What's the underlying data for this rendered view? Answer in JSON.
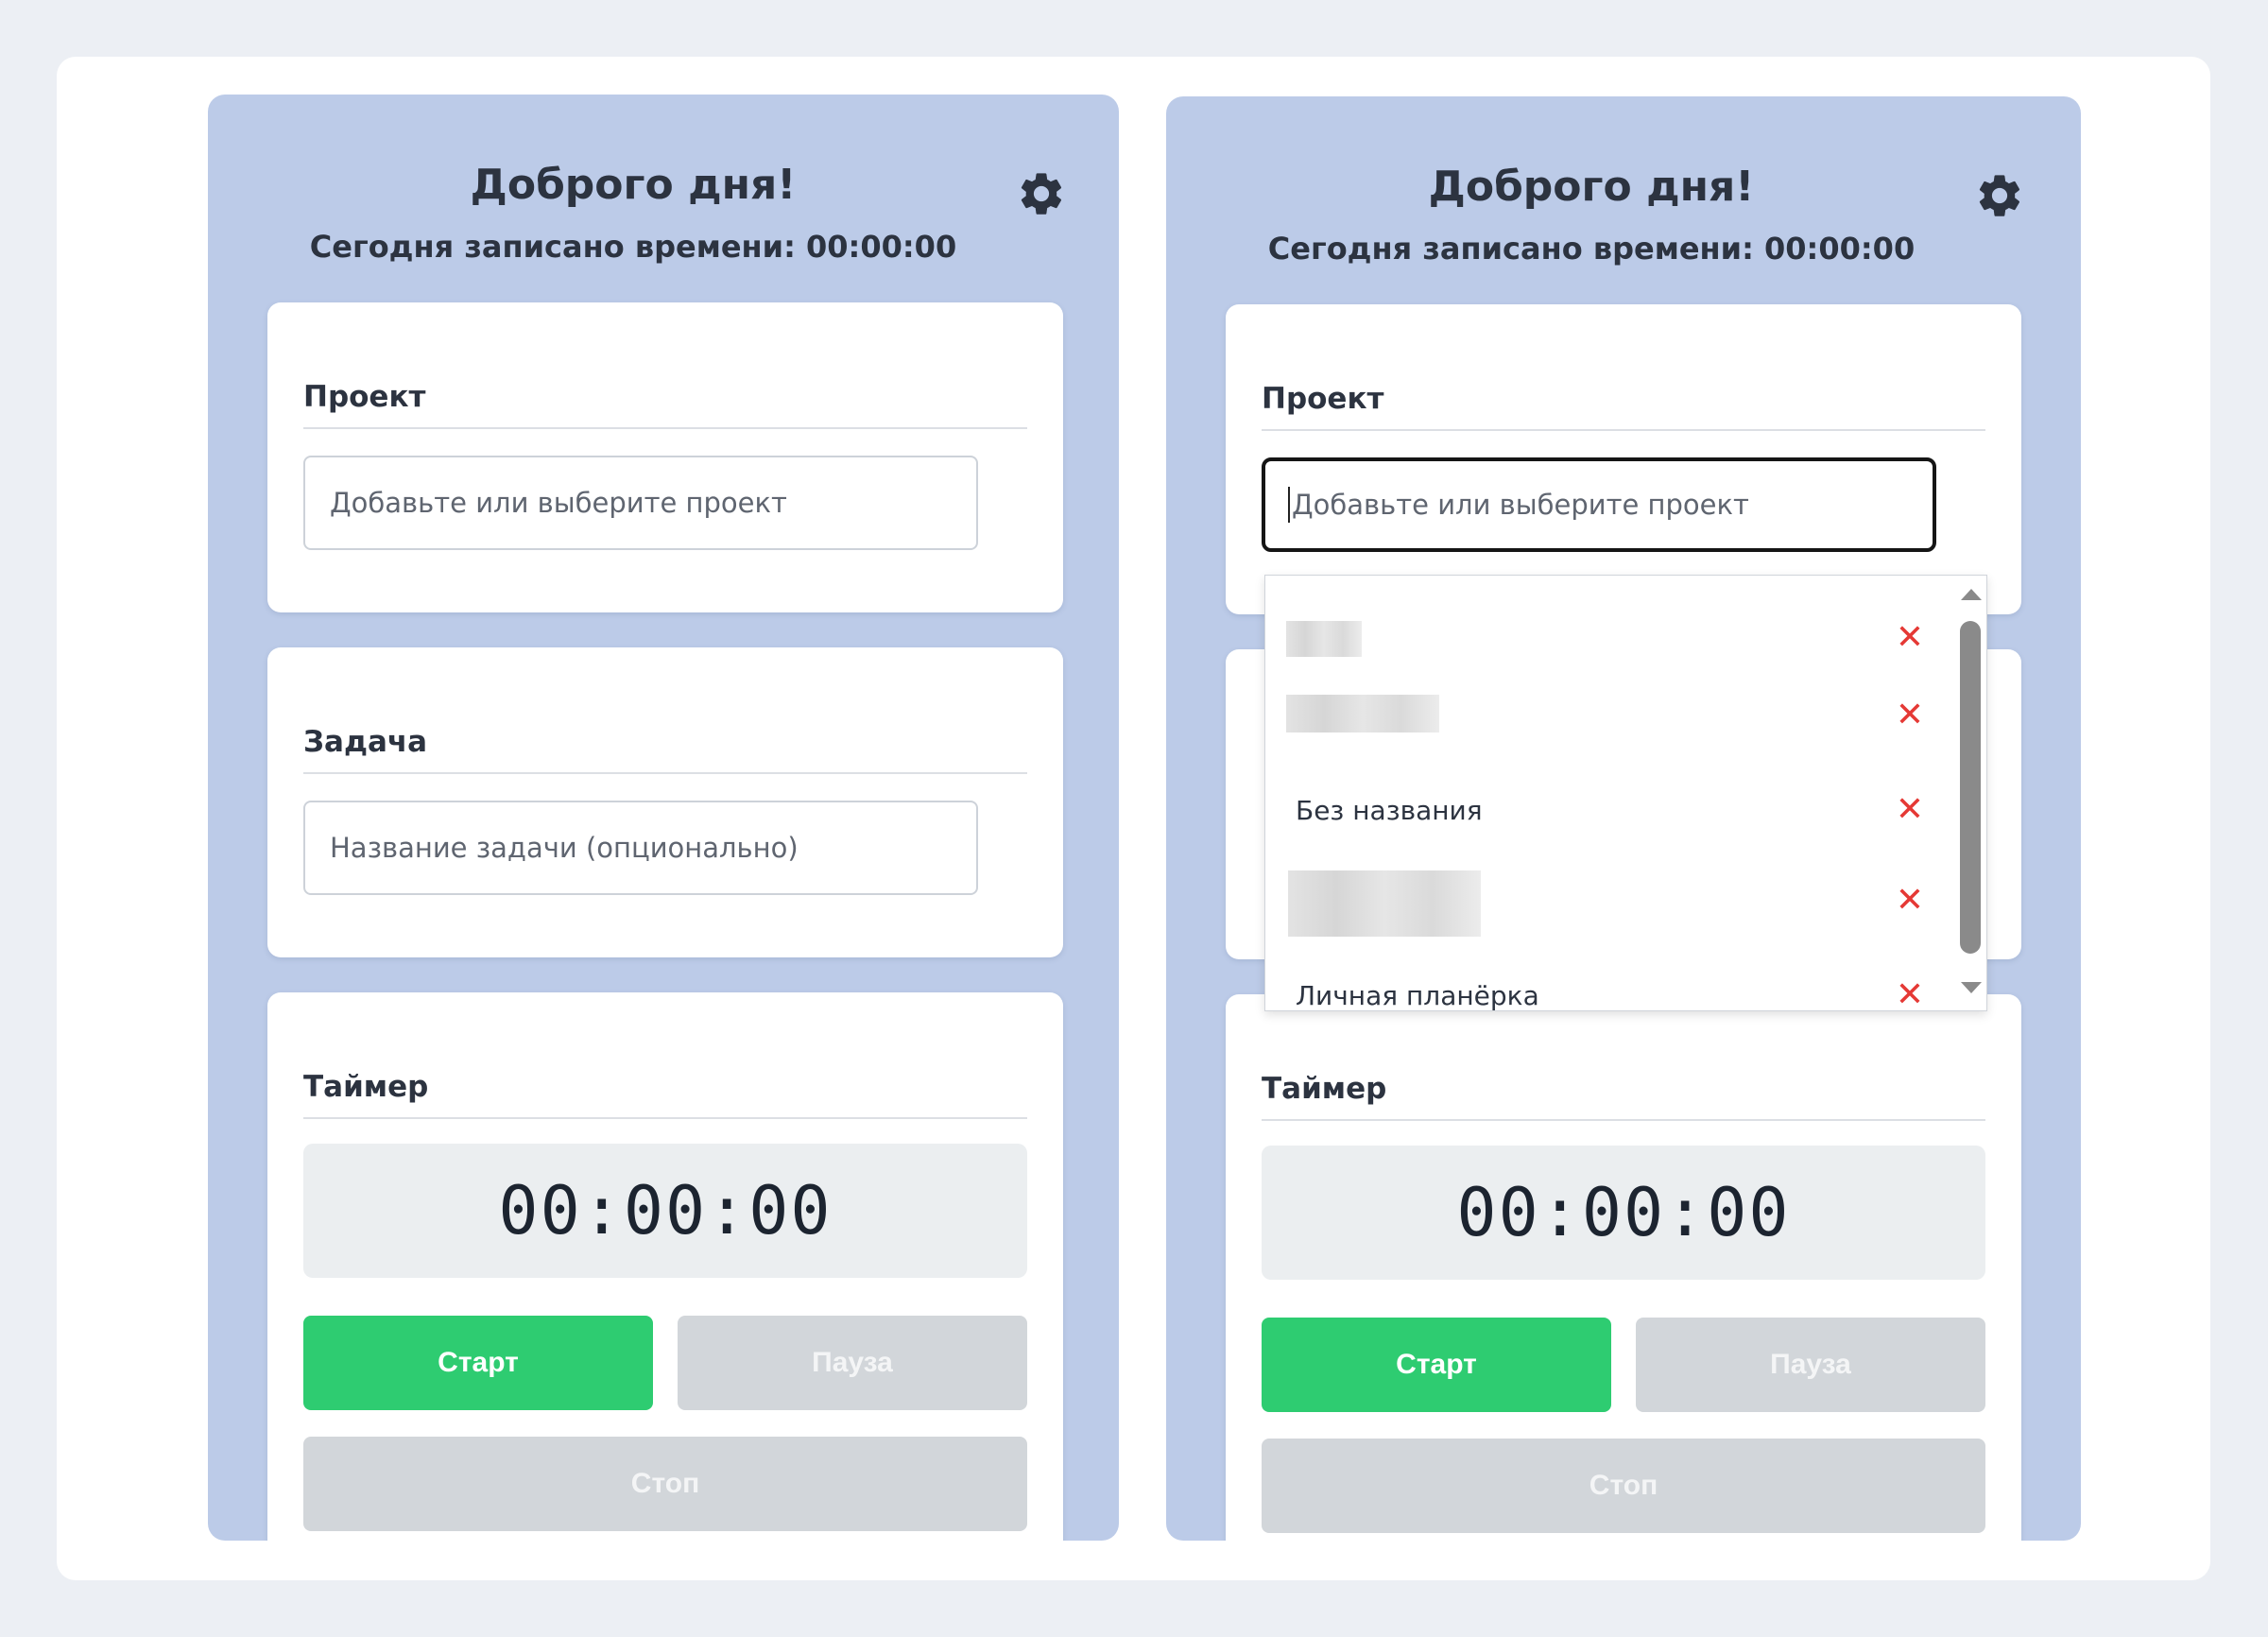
{
  "panels": [
    {
      "greeting": "Доброго дня!",
      "today_recorded": "Сегодня записано времени: 00:00:00",
      "project": {
        "title": "Проект",
        "placeholder": "Добавьте или выберите проект"
      },
      "task": {
        "title": "Задача",
        "placeholder": "Название задачи (опционально)"
      },
      "timer": {
        "title": "Таймер",
        "display": "00:00:00",
        "start_label": "Старт",
        "pause_label": "Пауза",
        "stop_label": "Стоп"
      }
    },
    {
      "greeting": "Доброго дня!",
      "today_recorded": "Сегодня записано времени: 00:00:00",
      "project": {
        "title": "Проект",
        "placeholder": "Добавьте или выберите проект"
      },
      "timer": {
        "title": "Таймер",
        "display": "00:00:00",
        "start_label": "Старт",
        "pause_label": "Пауза",
        "stop_label": "Стоп"
      }
    }
  ],
  "project_dropdown": {
    "items": [
      {
        "label": "",
        "blurred": true
      },
      {
        "label": "",
        "blurred": true
      },
      {
        "label": "Без названия",
        "blurred": false
      },
      {
        "label": "",
        "blurred": true
      },
      {
        "label": "Личная планёрка",
        "blurred": false
      }
    ],
    "delete_symbol": "✕"
  },
  "colors": {
    "panel_bg": "#bccbe8",
    "start_button": "#2ecc71",
    "disabled_button": "#d2d6da",
    "delete_icon": "#e53935"
  },
  "icons": [
    "gear-icon",
    "delete-icon",
    "scroll-up-icon",
    "scroll-down-icon"
  ]
}
